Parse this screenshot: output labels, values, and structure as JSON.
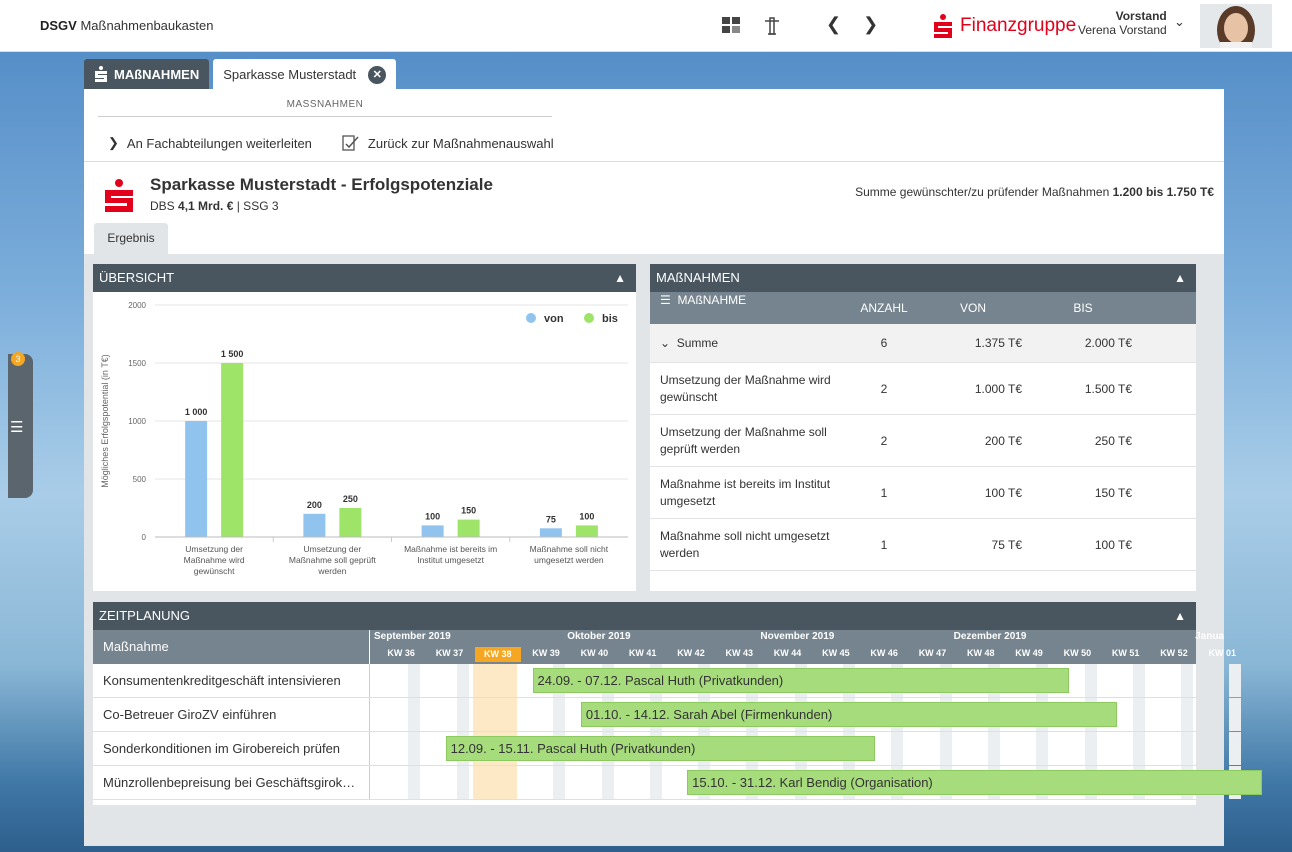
{
  "header": {
    "brand_bold": "DSGV",
    "brand_text": "Maßnahmenbaukasten",
    "finanzgruppe": "Finanzgruppe",
    "user_role": "Vorstand",
    "user_name": "Verena Vorstand"
  },
  "sidebar": {
    "badge": "3"
  },
  "tabs": {
    "massnahmen": "MAßNAHMEN",
    "sparkasse": "Sparkasse Musterstadt"
  },
  "toolbar": {
    "section_label": "MASSNAHMEN",
    "forward": "An Fachabteilungen weiterleiten",
    "back": "Zurück zur Maßnahmenauswahl"
  },
  "institute": {
    "title": "Sparkasse Musterstadt - Erfolgspotenziale",
    "dbs_label": "DBS",
    "dbs_value": "4,1 Mrd. €",
    "ssg": "| SSG 3",
    "summe_label": "Summe gewünschter/zu prüfender Maßnahmen",
    "summe_value": "1.200 bis 1.750 T€",
    "result_tab": "Ergebnis"
  },
  "overview": {
    "title": "ÜBERSICHT"
  },
  "chart_data": {
    "type": "bar",
    "ylabel": "Mögliches Erfolgspotential (in T€)",
    "ylim": [
      0,
      2000
    ],
    "yticks": [
      "0",
      "500",
      "1000",
      "1500",
      "2000"
    ],
    "legend_position": "top-right",
    "categories": [
      [
        "Umsetzung der",
        "Maßnahme wird",
        "gewünscht"
      ],
      [
        "Umsetzung der",
        "Maßnahme soll geprüft",
        "werden"
      ],
      [
        "Maßnahme ist bereits im",
        "Institut umgesetzt"
      ],
      [
        "Maßnahme soll nicht",
        "umgesetzt werden"
      ]
    ],
    "series": [
      {
        "name": "von",
        "color": "#90c4ef",
        "values": [
          1000,
          200,
          100,
          75
        ],
        "labels": [
          "1 000",
          "200",
          "100",
          "75"
        ]
      },
      {
        "name": "bis",
        "color": "#9de469",
        "values": [
          1500,
          250,
          150,
          100
        ],
        "labels": [
          "1 500",
          "250",
          "150",
          "100"
        ]
      }
    ]
  },
  "measures": {
    "title": "MAßNAHMEN",
    "columns": [
      "MAßNAHME",
      "ANZAHL",
      "VON",
      "BIS"
    ],
    "summe": {
      "label": "Summe",
      "count": "6",
      "von": "1.375 T€",
      "bis": "2.000 T€"
    },
    "rows": [
      {
        "label": "Umsetzung der Maßnahme wird gewünscht",
        "count": "2",
        "von": "1.000 T€",
        "bis": "1.500 T€"
      },
      {
        "label": "Umsetzung der Maßnahme soll geprüft werden",
        "count": "2",
        "von": "200 T€",
        "bis": "250 T€"
      },
      {
        "label": "Maßnahme ist bereits im Institut umgesetzt",
        "count": "1",
        "von": "100 T€",
        "bis": "150 T€"
      },
      {
        "label": "Maßnahme soll nicht umgesetzt werden",
        "count": "1",
        "von": "75 T€",
        "bis": "100 T€"
      }
    ]
  },
  "timeline": {
    "title": "ZEITPLANUNG",
    "col_label": "Maßnahme",
    "months": [
      "September 2019",
      "Oktober 2019",
      "November 2019",
      "Dezember 2019",
      "Janua"
    ],
    "weeks": [
      "KW 36",
      "KW 37",
      "KW 38",
      "KW 39",
      "KW 40",
      "KW 41",
      "KW 42",
      "KW 43",
      "KW 44",
      "KW 45",
      "KW 46",
      "KW 47",
      "KW 48",
      "KW 49",
      "KW 50",
      "KW 51",
      "KW 52",
      "KW 01"
    ],
    "current_week": "KW 38",
    "tasks": [
      {
        "name": "Konsumentenkreditgeschäft intensivieren",
        "bar": "24.09. - 07.12. Pascal Huth (Privatkunden)"
      },
      {
        "name": "Co-Betreuer GiroZV einführen",
        "bar": "01.10. - 14.12. Sarah Abel (Firmenkunden)"
      },
      {
        "name": "Sonderkonditionen im Girobereich prüfen",
        "bar": "12.09. - 15.11. Pascal Huth (Privatkunden)"
      },
      {
        "name": "Münzrollenbepreisung bei Geschäftsgirok…",
        "bar": "15.10. - 31.12. Karl Bendig (Organisation)"
      }
    ]
  }
}
